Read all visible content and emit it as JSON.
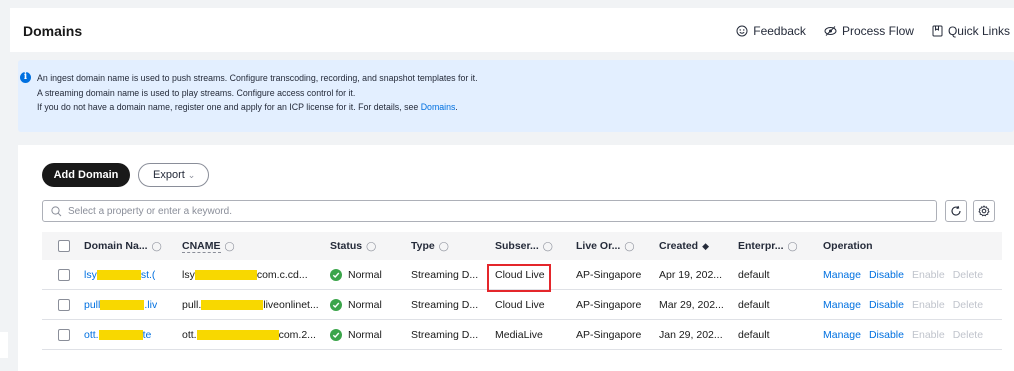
{
  "header": {
    "title": "Domains",
    "links": [
      {
        "label": "Feedback",
        "icon": "smile-icon"
      },
      {
        "label": "Process Flow",
        "icon": "flow-icon"
      },
      {
        "label": "Quick Links",
        "icon": "bookmark-icon"
      }
    ]
  },
  "info": {
    "line1": "An ingest domain name is used to push streams. Configure transcoding, recording, and snapshot templates for it.",
    "line2": "A streaming domain name is used to play streams. Configure access control for it.",
    "line3_prefix": "If you do not have a domain name, register one and apply for an ICP license for it. For details, see ",
    "line3_link": "Domains",
    "line3_suffix": "."
  },
  "toolbar": {
    "add_label": "Add Domain",
    "export_label": "Export"
  },
  "search": {
    "placeholder": "Select a property or enter a keyword."
  },
  "table": {
    "columns": [
      {
        "label": "Domain Na...",
        "filter": true
      },
      {
        "label": "CNAME",
        "filter": true
      },
      {
        "label": "Status",
        "filter": true
      },
      {
        "label": "Type",
        "filter": true
      },
      {
        "label": "Subser...",
        "filter": true
      },
      {
        "label": "Live Or...",
        "filter": true
      },
      {
        "label": "Created",
        "sort": true
      },
      {
        "label": "Enterpr...",
        "filter": true
      },
      {
        "label": "Operation"
      }
    ],
    "rows": [
      {
        "domain_prefix": "lsy",
        "domain_suffix": "st.(",
        "cname_prefix": "lsy",
        "cname_suffix": "com.c.cd...",
        "status": "Normal",
        "type": "Streaming D...",
        "subservice": "Cloud Live",
        "region": "AP-Singapore",
        "created": "Apr 19, 202...",
        "enterprise": "default"
      },
      {
        "domain_prefix": "pull",
        "domain_suffix": ".liv",
        "cname_prefix": "pull.",
        "cname_suffix": "liveonlinet...",
        "status": "Normal",
        "type": "Streaming D...",
        "subservice": "Cloud Live",
        "region": "AP-Singapore",
        "created": "Mar 29, 202...",
        "enterprise": "default"
      },
      {
        "domain_prefix": "ott.",
        "domain_suffix": "te",
        "cname_prefix": "ott.",
        "cname_suffix": "com.2...",
        "status": "Normal",
        "type": "Streaming D...",
        "subservice": "MediaLive",
        "region": "AP-Singapore",
        "created": "Jan 29, 202...",
        "enterprise": "default"
      }
    ],
    "operations": [
      "Manage",
      "Disable",
      "Enable",
      "Delete"
    ]
  },
  "colors": {
    "accent": "#0070e0",
    "status_ok": "#3ba54a",
    "highlight": "#e4262b",
    "mask": "#f8d800"
  }
}
